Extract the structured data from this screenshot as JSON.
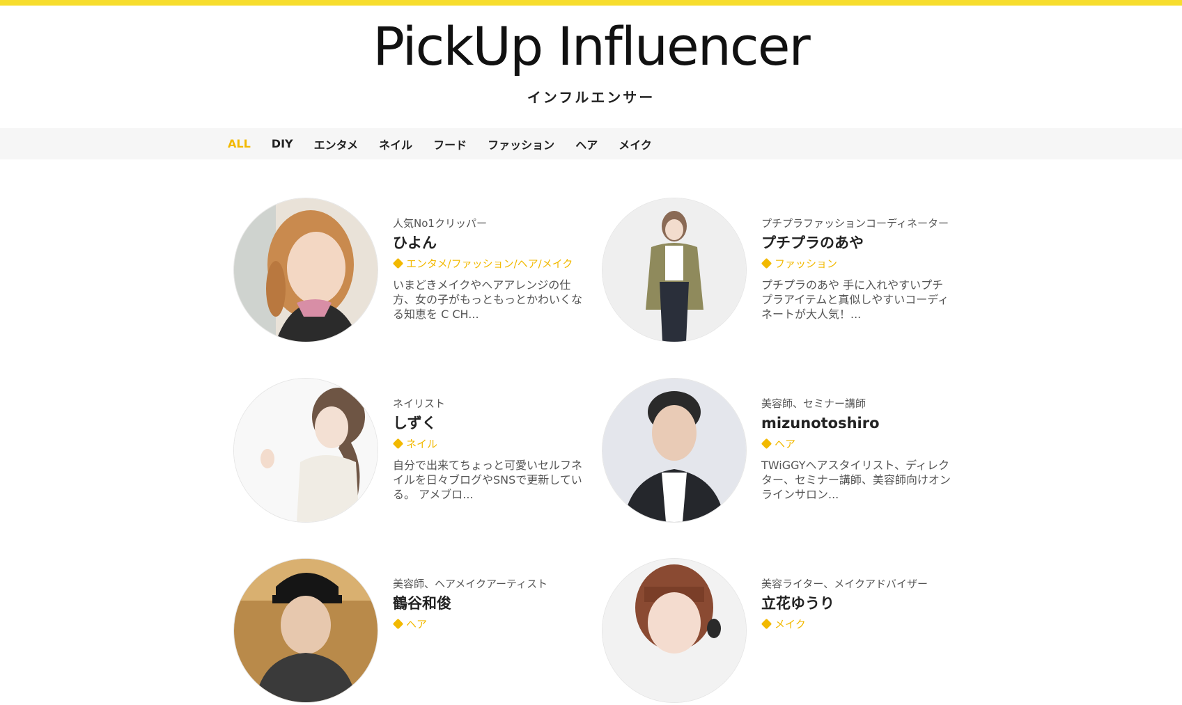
{
  "header": {
    "logo": "PickUp Influencer",
    "subtitle": "インフルエンサー"
  },
  "nav": {
    "items": [
      "ALL",
      "DIY",
      "エンタメ",
      "ネイル",
      "フード",
      "ファッション",
      "ヘア",
      "メイク"
    ],
    "active": "ALL"
  },
  "cards": [
    {
      "role": "人気No1クリッパー",
      "name": "ひよん",
      "tags": "エンタメ/ファッション/ヘア/メイク",
      "desc": "いまどきメイクやヘアアレンジの仕方、女の子がもっともっとかわいくなる知恵を C CH..."
    },
    {
      "role": "プチプラファッションコーディネーター",
      "name": "プチプラのあや",
      "tags": "ファッション",
      "desc": "プチプラのあや 手に入れやすいプチプラアイテムと真似しやすいコーディネートが大人気！..."
    },
    {
      "role": "ネイリスト",
      "name": "しずく",
      "tags": "ネイル",
      "desc": "自分で出来てちょっと可愛いセルフネイルを日々ブログやSNSで更新している。 アメブロ..."
    },
    {
      "role": "美容師、セミナー講師",
      "name": "mizunotoshiro",
      "tags": "ヘア",
      "desc": "TWiGGYヘアスタイリスト、ディレクター、セミナー講師、美容師向けオンラインサロン..."
    },
    {
      "role": "美容師、ヘアメイクアーティスト",
      "name": "鶴谷和俊",
      "tags": "ヘア",
      "desc": ""
    },
    {
      "role": "美容ライター、メイクアドバイザー",
      "name": "立花ゆうり",
      "tags": "メイク",
      "desc": ""
    }
  ],
  "colors": {
    "accent": "#f2b900",
    "top_bar": "#f7dd2d",
    "nav_bg": "#f6f6f6"
  }
}
